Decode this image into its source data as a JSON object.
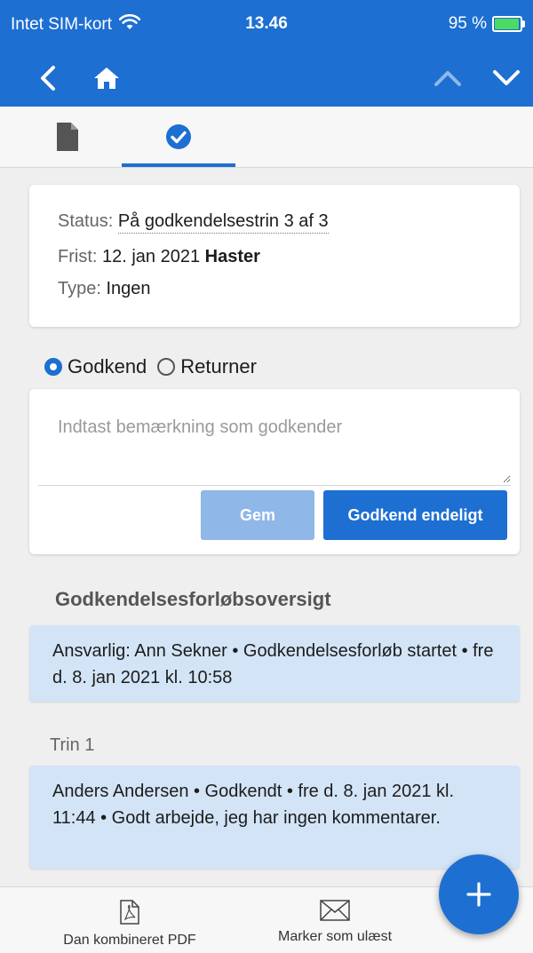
{
  "status_bar": {
    "carrier": "Intet SIM-kort",
    "time": "13.46",
    "battery": "95 %",
    "battery_level": 0.95
  },
  "nav": {
    "back_icon": "chevron-left-icon",
    "home_icon": "home-icon",
    "up_icon": "chevron-up-icon",
    "down_icon": "chevron-down-icon"
  },
  "tabs": [
    {
      "icon": "document-icon",
      "active": false
    },
    {
      "icon": "check-circle-icon",
      "active": true
    }
  ],
  "status_card": {
    "status_label": "Status:",
    "status_value": "På godkendelsestrin 3 af 3",
    "deadline_label": "Frist:",
    "deadline_value": "12. jan 2021",
    "urgent": "Haster",
    "type_label": "Type:",
    "type_value": "Ingen"
  },
  "decision": {
    "approve_label": "Godkend",
    "return_label": "Returner",
    "selected": "approve"
  },
  "comment": {
    "placeholder": "Indtast bemærkning som godkender",
    "value": ""
  },
  "buttons": {
    "save": "Gem",
    "approve_final": "Godkend endeligt"
  },
  "overview": {
    "title": "Godkendelsesforløbsoversigt",
    "start_entry": "Ansvarlig: Ann Sekner • Godkendelsesforløb startet •  fre d. 8. jan 2021 kl. 10:58",
    "steps": [
      {
        "label": "Trin 1",
        "entry": "Anders Andersen • Godkendt •  fre d. 8. jan 2021 kl. 11:44 • Godt arbejde, jeg har ingen kommentarer."
      }
    ]
  },
  "bottom_bar": {
    "pdf_label": "Dan kombineret PDF",
    "unread_label": "Marker som ulæst",
    "pdf_icon": "pdf-icon",
    "mail_icon": "mail-icon"
  },
  "fab": {
    "icon": "plus-icon"
  },
  "colors": {
    "accent": "#1d6fd1",
    "disabled_button": "#8fb7e8",
    "entry_background": "#d3e4f7"
  }
}
